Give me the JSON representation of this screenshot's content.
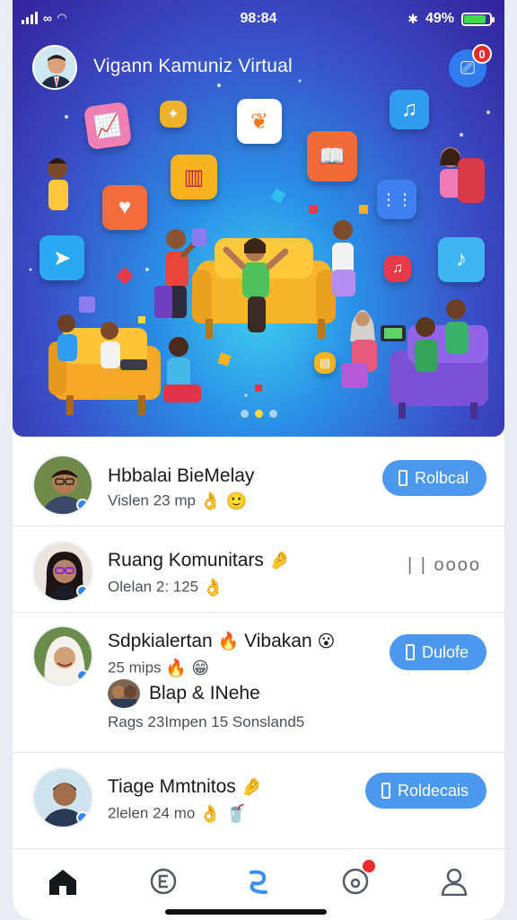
{
  "status": {
    "time": "98:84",
    "battery": "49%",
    "battery_level": 0.85
  },
  "header": {
    "title": "Vigann Kamuniz Virtual",
    "notification_count": "0"
  },
  "hero": {
    "carousel_pages": 3,
    "active_page": 1
  },
  "rows": [
    {
      "name": "Hbbalai BieMelay",
      "meta": "Vislen 23 mp",
      "meta_emoji": "👌 🙂",
      "button": "Rolbcal"
    },
    {
      "name": "Ruang Komunitars",
      "name_emoji": "🤌",
      "meta": "Olelan 2: 125",
      "meta_emoji": "👌",
      "status": "| | oooo"
    },
    {
      "name": "Sdpkialertan",
      "name_emoji": "🔥",
      "name_suffix": "Vibakan",
      "name_suffix_emoji": "😮",
      "meta": "25 mips",
      "meta_emoji": "🔥 😁",
      "sub_name": "Blap & INehe",
      "sub_meta": "Rags 23Impen 15 Sonsland5",
      "button": "Dulofe"
    },
    {
      "name": "Tiage Mmtnitos",
      "name_emoji": "🤌",
      "meta": "2lelen 24 mo",
      "meta_emoji": "👌 🥤",
      "button": "Roldecais"
    }
  ],
  "nav": [
    {
      "name": "home",
      "icon": "home-icon"
    },
    {
      "name": "feed",
      "icon": "e-icon"
    },
    {
      "name": "connect",
      "icon": "swirl-icon"
    },
    {
      "name": "alerts",
      "icon": "bell-icon"
    },
    {
      "name": "profile",
      "icon": "person-icon"
    }
  ],
  "colors": {
    "accent": "#4b98ee",
    "badge": "#ea2b2b",
    "hero_top": "#34229b",
    "hero_center": "#3fd0ef"
  }
}
